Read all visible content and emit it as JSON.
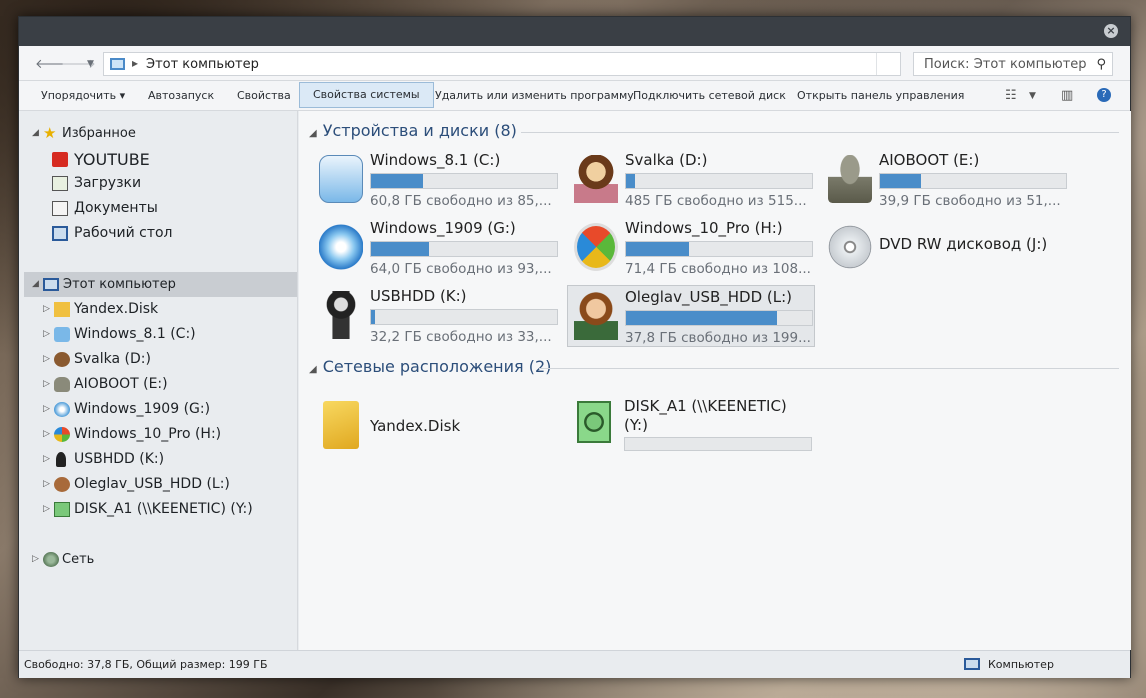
{
  "window": {
    "close_glyph": "×",
    "address": {
      "path": "Этот компьютер",
      "separator": "▸"
    },
    "search": {
      "placeholder": "Поиск: Этот компьютер"
    }
  },
  "toolbar": {
    "organize": "Упорядочить ▾",
    "autoplay": "Автозапуск",
    "properties": "Свойства",
    "system_properties": "Свойства системы",
    "uninstall": "Удалить или изменить программу",
    "map_drive": "Подключить сетевой диск",
    "control_panel": "Открыть панель управления"
  },
  "sidebar": {
    "favorites": {
      "label": "Избранное",
      "items": [
        "YOUTUBE",
        "Загрузки",
        "Документы",
        "Рабочий стол"
      ]
    },
    "computer": {
      "label": "Этот компьютер",
      "items": [
        "Yandex.Disk",
        "Windows_8.1 (C:)",
        "Svalka (D:)",
        "AIOBOOT (E:)",
        "Windows_1909 (G:)",
        "Windows_10_Pro (H:)",
        "USBHDD (K:)",
        "Oleglav_USB_HDD (L:)",
        "DISK_A1 (\\\\KEENETIC) (Y:)"
      ]
    },
    "network": {
      "label": "Сеть"
    }
  },
  "content": {
    "devices_header": "Устройства и диски (8)",
    "network_header": "Сетевые расположения (2)",
    "drives": [
      {
        "name": "Windows_8.1 (C:)",
        "free": "60,8 ГБ свободно из 85,...",
        "used_fraction": 0.28,
        "icon": "mac-monitor-icon"
      },
      {
        "name": "Svalka (D:)",
        "free": "485 ГБ свободно из 515...",
        "used_fraction": 0.05,
        "icon": "girl-avatar-icon"
      },
      {
        "name": "AIOBOOT (E:)",
        "free": "39,9 ГБ свободно из 51,...",
        "used_fraction": 0.22,
        "icon": "troll-avatar-icon"
      },
      {
        "name": "Windows_1909 (G:)",
        "free": "64,0 ГБ свободно из 93,...",
        "used_fraction": 0.31,
        "icon": "windows-orb-icon"
      },
      {
        "name": "Windows_10_Pro (H:)",
        "free": "71,4 ГБ свободно из 108...",
        "used_fraction": 0.34,
        "icon": "windows-flag-icon"
      },
      {
        "name": "DVD RW дисковод (J:)",
        "free": "",
        "used_fraction": null,
        "icon": "dvd-icon"
      },
      {
        "name": "USBHDD (K:)",
        "free": "32,2 ГБ свободно из 33,...",
        "used_fraction": 0.02,
        "icon": "ninja-avatar-icon"
      },
      {
        "name": "Oleglav_USB_HDD (L:)",
        "free": "37,8 ГБ свободно из 199...",
        "used_fraction": 0.81,
        "icon": "boy-avatar-icon"
      }
    ],
    "network_items": [
      {
        "name": "Yandex.Disk",
        "icon": "yandex-folder-icon"
      },
      {
        "name": "DISK_A1 (\\\\KEENETIC)",
        "name2": "(Y:)",
        "icon": "network-drive-icon"
      }
    ]
  },
  "status": {
    "left": "Свободно: 37,8 ГБ, Общий размер: 199 ГБ",
    "right": "Компьютер"
  },
  "colors": {
    "accent": "#4a8dc9",
    "header": "#2c4e7a",
    "titlebar": "#3a3f45"
  }
}
